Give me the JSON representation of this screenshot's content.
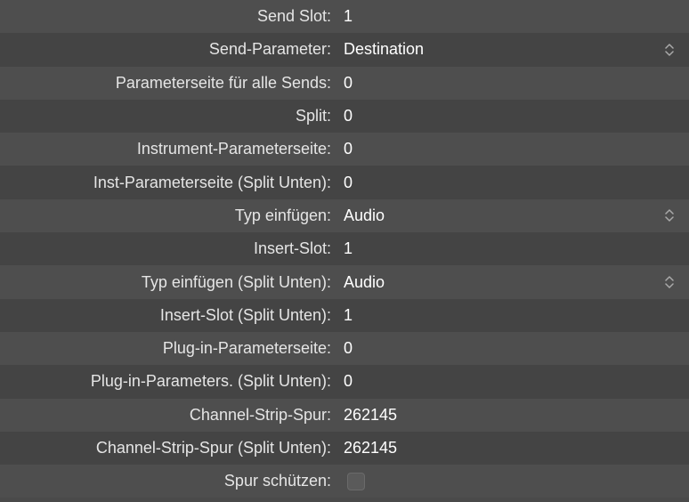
{
  "rows": [
    {
      "label": "Send Slot:",
      "value": "1",
      "type": "text"
    },
    {
      "label": "Send-Parameter:",
      "value": "Destination",
      "type": "dropdown"
    },
    {
      "label": "Parameterseite für alle Sends:",
      "value": "0",
      "type": "text"
    },
    {
      "label": "Split:",
      "value": "0",
      "type": "text"
    },
    {
      "label": "Instrument-Parameterseite:",
      "value": "0",
      "type": "text"
    },
    {
      "label": "Inst-Parameterseite (Split Unten):",
      "value": "0",
      "type": "text"
    },
    {
      "label": "Typ einfügen:",
      "value": "Audio",
      "type": "dropdown"
    },
    {
      "label": "Insert-Slot:",
      "value": "1",
      "type": "text"
    },
    {
      "label": "Typ einfügen (Split Unten):",
      "value": "Audio",
      "type": "dropdown"
    },
    {
      "label": "Insert-Slot (Split Unten):",
      "value": "1",
      "type": "text"
    },
    {
      "label": "Plug-in-Parameterseite:",
      "value": "0",
      "type": "text"
    },
    {
      "label": "Plug-in-Parameters. (Split Unten):",
      "value": "0",
      "type": "text"
    },
    {
      "label": "Channel-Strip-Spur:",
      "value": "262145",
      "type": "text"
    },
    {
      "label": "Channel-Strip-Spur (Split Unten):",
      "value": "262145",
      "type": "text"
    },
    {
      "label": "Spur schützen:",
      "value": "",
      "type": "checkbox"
    }
  ]
}
